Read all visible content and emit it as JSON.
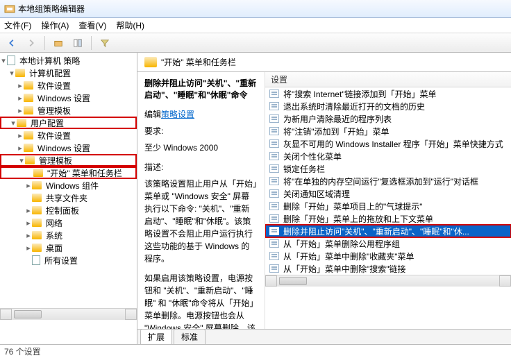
{
  "window": {
    "title": "本地组策略编辑器"
  },
  "menu": {
    "file": "文件(F)",
    "action": "操作(A)",
    "view": "查看(V)",
    "help": "帮助(H)"
  },
  "tree": {
    "root": "本地计算机 策略",
    "computer_cfg": "计算机配置",
    "cc_soft": "软件设置",
    "cc_win": "Windows 设置",
    "cc_admin": "管理模板",
    "user_cfg": "用户配置",
    "uc_soft": "软件设置",
    "uc_win": "Windows 设置",
    "uc_admin": "管理模板",
    "start": "\"开始\" 菜单和任务栏",
    "win_comp": "Windows 组件",
    "share": "共享文件夹",
    "ctrl": "控制面板",
    "net": "网络",
    "sys": "系统",
    "desk": "桌面",
    "all": "所有设置"
  },
  "heading": "\"开始\" 菜单和任务栏",
  "desc": {
    "title": "删除并阻止访问\"关机\"、\"重新启动\"、\"睡眠\"和\"休眠\"命令",
    "edit_label": "编辑",
    "edit_link": "策略设置",
    "req_label": "要求:",
    "req_val": "至少 Windows 2000",
    "d_label": "描述:",
    "d1": "该策略设置阻止用户从「开始」菜单或 \"Windows 安全\" 屏幕执行以下命令: \"关机\"、\"重新启动\"、\"睡眠\"和\"休眠\"。该策略设置不会阻止用户运行执行这些功能的基于 Windows 的程序。",
    "d2": "如果启用该策略设置，电源按钮和 \"关机\"、\"重新启动\"、\"睡眠\" 和 \"休眠\"命令将从「开始」菜单删除。电源按钮也会从 \"Windows 安全\" 屏幕删除。该"
  },
  "list": {
    "header": "设置",
    "items": [
      "将\"搜索 Internet\"链接添加到「开始」菜单",
      "退出系统时清除最近打开的文档的历史",
      "为新用户清除最近的程序列表",
      "将\"注销\"添加到「开始」菜单",
      "灰显不可用的 Windows Installer 程序「开始」菜单快捷方式",
      "关闭个性化菜单",
      "锁定任务栏",
      "将\"在单独的内存空间运行\"复选框添加到\"运行\"对话框",
      "关闭通知区域清理",
      "删除「开始」菜单项目上的\"气球提示\"",
      "删除「开始」菜单上的拖放和上下文菜单",
      "删除并阻止访问\"关机\"、\"重新启动\"、\"睡眠\"和\"休...",
      "从「开始」菜单删除公用程序组",
      "从「开始」菜单中删除\"收藏夹\"菜单",
      "从「开始」菜单中删除\"搜索\"链接"
    ],
    "selected_index": 11
  },
  "tabs": {
    "ext": "扩展",
    "std": "标准"
  },
  "status": "76 个设置"
}
